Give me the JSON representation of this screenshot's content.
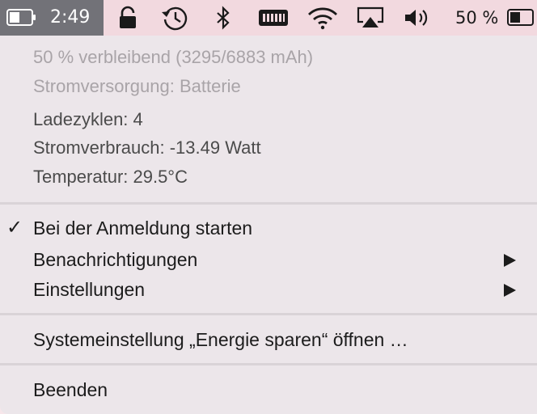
{
  "menubar": {
    "time": "2:49",
    "battery_percent": "50 %",
    "battery_level": 0.5,
    "icons": [
      "battery-icon",
      "lock-icon",
      "time-machine-icon",
      "bluetooth-icon",
      "ram-icon",
      "wifi-icon",
      "airplay-icon",
      "volume-icon",
      "battery-icon"
    ]
  },
  "menu": {
    "info": {
      "remaining": "50 % verbleibend (3295/6883 mAh)",
      "power_source": "Stromversorgung: Batterie",
      "cycles": "Ladezyklen: 4",
      "consumption": "Stromverbrauch: -13.49 Watt",
      "temperature": "Temperatur: 29.5°C"
    },
    "items": {
      "login_start": "Bei der Anmeldung starten",
      "login_check": "✓",
      "notifications": "Benachrichtigungen",
      "settings": "Einstellungen",
      "system_prefs": "Systemeinstellung „Energie sparen“ öffnen …",
      "quit": "Beenden"
    }
  }
}
